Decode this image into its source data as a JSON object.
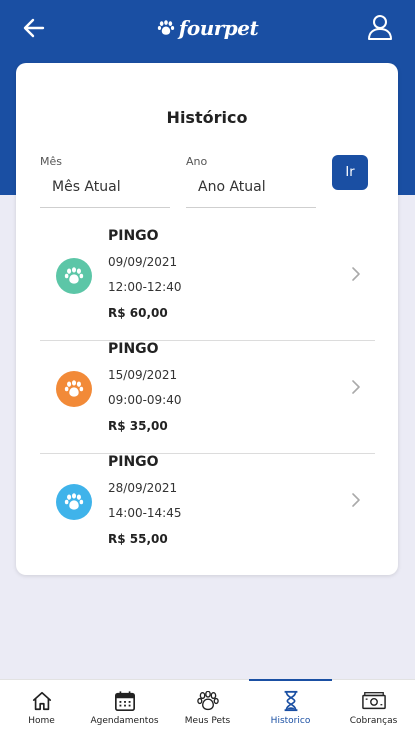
{
  "header": {
    "logo_text": "fourpet"
  },
  "history": {
    "title": "Histórico",
    "month": {
      "label": "Mês",
      "value": "Mês Atual"
    },
    "year": {
      "label": "Ano",
      "value": "Ano Atual"
    },
    "go_label": "Ir",
    "items": [
      {
        "name": "PINGO",
        "date": "09/09/2021",
        "time": "12:00-12:40",
        "price": "R$ 60,00",
        "color": "#5cc6a7"
      },
      {
        "name": "PINGO",
        "date": "15/09/2021",
        "time": "09:00-09:40",
        "price": "R$ 35,00",
        "color": "#f28a38"
      },
      {
        "name": "PINGO",
        "date": "28/09/2021",
        "time": "14:00-14:45",
        "price": "R$ 55,00",
        "color": "#3fb3ea"
      }
    ]
  },
  "nav": {
    "active": "Historico",
    "items": [
      {
        "label": "Home",
        "icon": "home-icon"
      },
      {
        "label": "Agendamentos",
        "icon": "calendar-icon"
      },
      {
        "label": "Meus Pets",
        "icon": "paw-icon"
      },
      {
        "label": "Historico",
        "icon": "hourglass-icon"
      },
      {
        "label": "Cobranças",
        "icon": "money-icon"
      }
    ]
  },
  "colors": {
    "brand": "#1a4fa3",
    "background": "#ebebf5"
  }
}
